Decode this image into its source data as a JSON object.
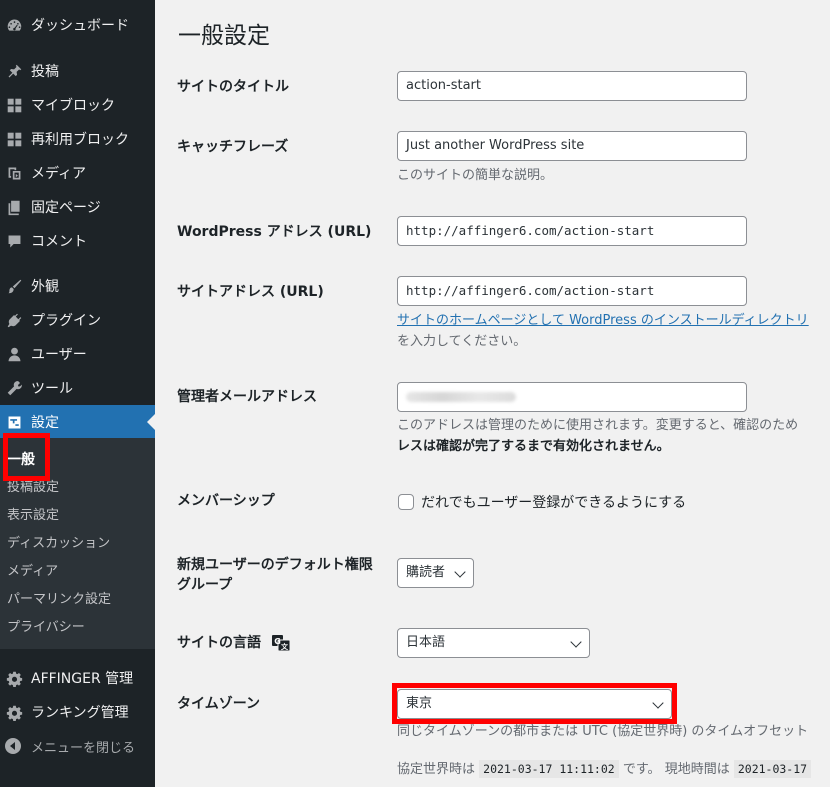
{
  "sidebar": {
    "items": [
      {
        "label": "ダッシュボード",
        "icon": "dashboard-icon"
      },
      {
        "label": "投稿",
        "icon": "pin-icon"
      },
      {
        "label": "マイブロック",
        "icon": "blocks-grid-icon"
      },
      {
        "label": "再利用ブロック",
        "icon": "blocks-grid-icon"
      },
      {
        "label": "メディア",
        "icon": "media-icon"
      },
      {
        "label": "固定ページ",
        "icon": "pages-icon"
      },
      {
        "label": "コメント",
        "icon": "comment-icon"
      },
      {
        "label": "外観",
        "icon": "paintbrush-icon"
      },
      {
        "label": "プラグイン",
        "icon": "plugin-icon"
      },
      {
        "label": "ユーザー",
        "icon": "user-icon"
      },
      {
        "label": "ツール",
        "icon": "wrench-icon"
      },
      {
        "label": "設定",
        "icon": "settings-icon"
      }
    ],
    "submenu": [
      "一般",
      "投稿設定",
      "表示設定",
      "ディスカッション",
      "メディア",
      "パーマリンク設定",
      "プライバシー"
    ],
    "bottom_items": [
      {
        "label": "AFFINGER 管理",
        "icon": "gear-icon"
      },
      {
        "label": "ランキング管理",
        "icon": "gear-icon"
      }
    ],
    "collapse_label": "メニューを閉じる"
  },
  "page": {
    "title": "一般設定",
    "site_title": {
      "label": "サイトのタイトル",
      "value": "action-start"
    },
    "tagline": {
      "label": "キャッチフレーズ",
      "value": "Just another WordPress site",
      "desc": "このサイトの簡単な説明。"
    },
    "wp_address": {
      "label": "WordPress アドレス (URL)",
      "value": "http://affinger6.com/action-start"
    },
    "site_address": {
      "label": "サイトアドレス (URL)",
      "value": "http://affinger6.com/action-start",
      "desc_link": "サイトのホームページとして WordPress のインストールディレクトリ",
      "desc_rest": "を入力してください。"
    },
    "admin_email": {
      "label": "管理者メールアドレス",
      "desc_line1": "このアドレスは管理のために使用されます。変更すると、確認のため",
      "desc_line2": "レスは確認が完了するまで有効化されません。"
    },
    "membership": {
      "label": "メンバーシップ",
      "checkbox_label": "だれでもユーザー登録ができるようにする"
    },
    "default_role": {
      "label_line1": "新規ユーザーのデフォルト権限",
      "label_line2": "グループ",
      "value": "購読者"
    },
    "site_language": {
      "label": "サイトの言語",
      "value": "日本語"
    },
    "timezone": {
      "label": "タイムゾーン",
      "value": "東京",
      "desc": "同じタイムゾーンの都市または UTC (協定世界時) のタイムオフセット",
      "utc_prefix": "協定世界時は",
      "utc_time": "2021-03-17 11:11:02",
      "utc_suffix": "です。 現地時間は",
      "local_time": "2021-03-17"
    }
  }
}
